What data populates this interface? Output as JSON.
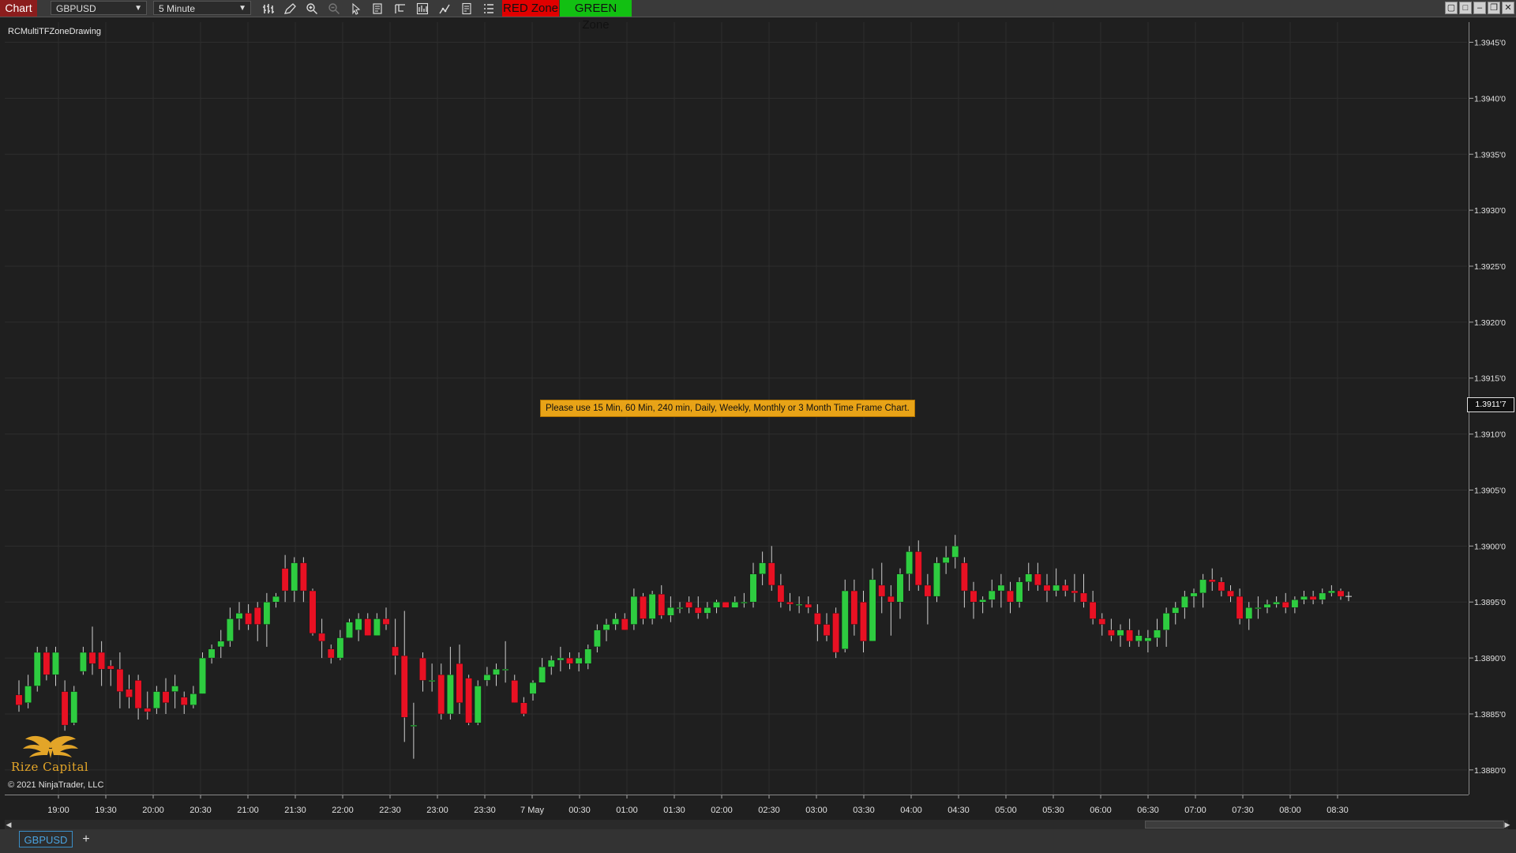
{
  "toolbar": {
    "chart_tab": "Chart",
    "instrument": "GBPUSD",
    "interval": "5 Minute",
    "red_zone": "RED Zone",
    "green_zone": "GREEN Zone",
    "icons": [
      "bar-type-icon",
      "pencil-draw-icon",
      "zoom-in-icon",
      "zoom-out-icon",
      "pointer-icon",
      "data-box-icon",
      "properties-icon",
      "indicators-icon",
      "strategies-icon",
      "order-icon",
      "objects-list-icon"
    ]
  },
  "chart": {
    "indicator_label": "RCMultiTFZoneDrawing",
    "notice": "Please use 15 Min, 60 Min, 240 min, Daily, Weekly, Monthly or 3 Month Time Frame Chart.",
    "copyright": "© 2021 NinjaTrader, LLC",
    "logo_text": "Rize Capital",
    "current_price": "1.3911'7",
    "colors": {
      "up": "#2ecc40",
      "down": "#e81123",
      "background": "#1f1f1f",
      "grid": "#2e2e2e"
    }
  },
  "chart_data": {
    "type": "candlestick",
    "title": "",
    "price_ticks": [
      "1.3880'0",
      "1.3885'0",
      "1.3890'0",
      "1.3895'0",
      "1.3900'0",
      "1.3905'0",
      "1.3910'0",
      "1.3915'0",
      "1.3920'0",
      "1.3925'0",
      "1.3930'0",
      "1.3935'0",
      "1.3940'0",
      "1.3945'0"
    ],
    "time_ticks": [
      "19:00",
      "19:30",
      "20:00",
      "20:30",
      "21:00",
      "21:30",
      "22:00",
      "22:30",
      "23:00",
      "23:30",
      "7 May",
      "00:30",
      "01:00",
      "01:30",
      "02:00",
      "02:30",
      "03:00",
      "03:30",
      "04:00",
      "04:30",
      "05:00",
      "05:30",
      "06:00",
      "06:30",
      "07:00",
      "07:30",
      "08:00",
      "08:30"
    ],
    "ylim": [
      1.38778,
      1.39468
    ],
    "grid": true,
    "candles": [
      [
        1.38867,
        1.3888,
        1.38852,
        1.38858
      ],
      [
        1.3886,
        1.38885,
        1.38855,
        1.38875
      ],
      [
        1.38875,
        1.3891,
        1.3887,
        1.38905
      ],
      [
        1.38905,
        1.3891,
        1.3888,
        1.38885
      ],
      [
        1.38885,
        1.3891,
        1.38875,
        1.38905
      ],
      [
        1.3887,
        1.3888,
        1.38835,
        1.3884
      ],
      [
        1.38842,
        1.38875,
        1.3884,
        1.3887
      ],
      [
        1.38888,
        1.3891,
        1.38885,
        1.38905
      ],
      [
        1.38905,
        1.38928,
        1.38885,
        1.38895
      ],
      [
        1.38905,
        1.38915,
        1.38875,
        1.3889
      ],
      [
        1.38893,
        1.38898,
        1.38875,
        1.3889
      ],
      [
        1.3889,
        1.38905,
        1.38855,
        1.3887
      ],
      [
        1.38872,
        1.38885,
        1.38855,
        1.38865
      ],
      [
        1.3888,
        1.38885,
        1.38845,
        1.38855
      ],
      [
        1.38855,
        1.3887,
        1.38845,
        1.38852
      ],
      [
        1.38855,
        1.38875,
        1.3885,
        1.3887
      ],
      [
        1.3887,
        1.38882,
        1.3885,
        1.3886
      ],
      [
        1.3887,
        1.38885,
        1.38855,
        1.38875
      ],
      [
        1.38865,
        1.3887,
        1.3885,
        1.38858
      ],
      [
        1.38858,
        1.38875,
        1.38855,
        1.38868
      ],
      [
        1.38868,
        1.38905,
        1.38868,
        1.389
      ],
      [
        1.389,
        1.38912,
        1.38895,
        1.38908
      ],
      [
        1.3891,
        1.38925,
        1.389,
        1.38915
      ],
      [
        1.38915,
        1.38945,
        1.3891,
        1.38935
      ],
      [
        1.38935,
        1.3895,
        1.38925,
        1.3894
      ],
      [
        1.3894,
        1.38948,
        1.38925,
        1.3893
      ],
      [
        1.38945,
        1.3895,
        1.38915,
        1.3893
      ],
      [
        1.3893,
        1.38958,
        1.3891,
        1.3895
      ],
      [
        1.3895,
        1.38958,
        1.38945,
        1.38955
      ],
      [
        1.3898,
        1.38992,
        1.3895,
        1.3896
      ],
      [
        1.3896,
        1.3899,
        1.3895,
        1.38985
      ],
      [
        1.38985,
        1.3899,
        1.3895,
        1.3896
      ],
      [
        1.3896,
        1.38962,
        1.3892,
        1.38922
      ],
      [
        1.38922,
        1.38935,
        1.389,
        1.38915
      ],
      [
        1.38908,
        1.38912,
        1.38895,
        1.389
      ],
      [
        1.389,
        1.38925,
        1.38898,
        1.38918
      ],
      [
        1.38918,
        1.38935,
        1.38918,
        1.38932
      ],
      [
        1.38925,
        1.3894,
        1.38915,
        1.38935
      ],
      [
        1.38935,
        1.3894,
        1.3892,
        1.3892
      ],
      [
        1.3892,
        1.3894,
        1.3892,
        1.38935
      ],
      [
        1.38935,
        1.38945,
        1.38925,
        1.3893
      ],
      [
        1.3891,
        1.38935,
        1.38885,
        1.38902
      ],
      [
        1.38902,
        1.38942,
        1.38825,
        1.38847
      ],
      [
        1.3884,
        1.3886,
        1.3881,
        1.3884
      ],
      [
        1.389,
        1.38905,
        1.3887,
        1.3888
      ],
      [
        1.3888,
        1.38895,
        1.3887,
        1.3888
      ],
      [
        1.38885,
        1.38895,
        1.38845,
        1.3885
      ],
      [
        1.3885,
        1.3891,
        1.38845,
        1.38885
      ],
      [
        1.38895,
        1.38912,
        1.3885,
        1.3886
      ],
      [
        1.38882,
        1.38885,
        1.3884,
        1.38842
      ],
      [
        1.38842,
        1.3888,
        1.3884,
        1.38875
      ],
      [
        1.3888,
        1.38892,
        1.38875,
        1.38885
      ],
      [
        1.38885,
        1.38895,
        1.38875,
        1.3889
      ],
      [
        1.3889,
        1.38915,
        1.38878,
        1.3889
      ],
      [
        1.3888,
        1.38885,
        1.3886,
        1.3886
      ],
      [
        1.3886,
        1.38865,
        1.38848,
        1.3885
      ],
      [
        1.38868,
        1.3888,
        1.38862,
        1.38878
      ],
      [
        1.38878,
        1.389,
        1.38878,
        1.38892
      ],
      [
        1.38892,
        1.38902,
        1.38885,
        1.38898
      ],
      [
        1.38898,
        1.3891,
        1.38888,
        1.389
      ],
      [
        1.389,
        1.38905,
        1.3889,
        1.38895
      ],
      [
        1.38895,
        1.38905,
        1.38888,
        1.389
      ],
      [
        1.38895,
        1.38912,
        1.3889,
        1.38908
      ],
      [
        1.3891,
        1.3893,
        1.38905,
        1.38925
      ],
      [
        1.38925,
        1.38935,
        1.38915,
        1.3893
      ],
      [
        1.3893,
        1.3894,
        1.38925,
        1.38935
      ],
      [
        1.38935,
        1.3894,
        1.38925,
        1.38925
      ],
      [
        1.3893,
        1.38962,
        1.38925,
        1.38955
      ],
      [
        1.38955,
        1.38958,
        1.3893,
        1.38935
      ],
      [
        1.38935,
        1.3896,
        1.3893,
        1.38957
      ],
      [
        1.38957,
        1.38965,
        1.38935,
        1.38938
      ],
      [
        1.38938,
        1.38955,
        1.38932,
        1.38945
      ],
      [
        1.38945,
        1.3895,
        1.3894,
        1.38945
      ],
      [
        1.3895,
        1.38955,
        1.3894,
        1.38945
      ],
      [
        1.38945,
        1.38955,
        1.38935,
        1.3894
      ],
      [
        1.3894,
        1.3895,
        1.38935,
        1.38945
      ],
      [
        1.38945,
        1.38952,
        1.3894,
        1.3895
      ],
      [
        1.3895,
        1.3895,
        1.38945,
        1.38945
      ],
      [
        1.38945,
        1.38955,
        1.38945,
        1.3895
      ],
      [
        1.3895,
        1.38958,
        1.38945,
        1.3895
      ],
      [
        1.3895,
        1.38985,
        1.38945,
        1.38975
      ],
      [
        1.38975,
        1.38995,
        1.38965,
        1.38985
      ],
      [
        1.38985,
        1.39,
        1.3896,
        1.38965
      ],
      [
        1.38965,
        1.38975,
        1.38945,
        1.3895
      ],
      [
        1.3895,
        1.38958,
        1.38942,
        1.38948
      ],
      [
        1.38948,
        1.38955,
        1.3894,
        1.38948
      ],
      [
        1.38948,
        1.38955,
        1.3894,
        1.38945
      ],
      [
        1.3894,
        1.38948,
        1.38915,
        1.3893
      ],
      [
        1.3893,
        1.3894,
        1.38915,
        1.3892
      ],
      [
        1.3894,
        1.38945,
        1.389,
        1.38905
      ],
      [
        1.38908,
        1.3897,
        1.38905,
        1.3896
      ],
      [
        1.3896,
        1.3897,
        1.3892,
        1.3893
      ],
      [
        1.3895,
        1.3896,
        1.38905,
        1.38915
      ],
      [
        1.38915,
        1.3898,
        1.38915,
        1.3897
      ],
      [
        1.38965,
        1.38985,
        1.3894,
        1.38955
      ],
      [
        1.38955,
        1.38965,
        1.3892,
        1.3895
      ],
      [
        1.3895,
        1.3898,
        1.38935,
        1.38975
      ],
      [
        1.38975,
        1.39,
        1.3896,
        1.38995
      ],
      [
        1.38995,
        1.39005,
        1.3896,
        1.38965
      ],
      [
        1.38965,
        1.38975,
        1.3893,
        1.38955
      ],
      [
        1.38955,
        1.3899,
        1.3895,
        1.38985
      ],
      [
        1.38985,
        1.39,
        1.38975,
        1.3899
      ],
      [
        1.3899,
        1.3901,
        1.3898,
        1.39
      ],
      [
        1.38985,
        1.3899,
        1.38945,
        1.3896
      ],
      [
        1.3896,
        1.38968,
        1.38935,
        1.3895
      ],
      [
        1.3895,
        1.38955,
        1.3894,
        1.38952
      ],
      [
        1.38952,
        1.3897,
        1.38945,
        1.3896
      ],
      [
        1.3896,
        1.38975,
        1.38945,
        1.38965
      ],
      [
        1.3896,
        1.38968,
        1.3894,
        1.3895
      ],
      [
        1.3895,
        1.38972,
        1.38945,
        1.38968
      ],
      [
        1.38968,
        1.38985,
        1.3896,
        1.38975
      ],
      [
        1.38975,
        1.38985,
        1.3896,
        1.38965
      ],
      [
        1.38965,
        1.38975,
        1.3895,
        1.3896
      ],
      [
        1.3896,
        1.3898,
        1.38955,
        1.38965
      ],
      [
        1.38965,
        1.3897,
        1.38955,
        1.3896
      ],
      [
        1.3896,
        1.38975,
        1.3895,
        1.38958
      ],
      [
        1.38958,
        1.38975,
        1.38945,
        1.3895
      ],
      [
        1.3895,
        1.3896,
        1.3893,
        1.38935
      ],
      [
        1.38935,
        1.3894,
        1.3892,
        1.3893
      ],
      [
        1.38925,
        1.38935,
        1.38915,
        1.3892
      ],
      [
        1.3892,
        1.3893,
        1.3891,
        1.38925
      ],
      [
        1.38925,
        1.38935,
        1.3891,
        1.38915
      ],
      [
        1.38915,
        1.38925,
        1.3891,
        1.3892
      ],
      [
        1.38915,
        1.38925,
        1.38905,
        1.38918
      ],
      [
        1.38918,
        1.38935,
        1.3891,
        1.38925
      ],
      [
        1.38925,
        1.38945,
        1.3891,
        1.3894
      ],
      [
        1.3894,
        1.3895,
        1.3893,
        1.38945
      ],
      [
        1.38945,
        1.3896,
        1.38935,
        1.38955
      ],
      [
        1.38955,
        1.38962,
        1.38945,
        1.38958
      ],
      [
        1.38958,
        1.38975,
        1.38945,
        1.3897
      ],
      [
        1.3897,
        1.3898,
        1.3896,
        1.38968
      ],
      [
        1.38968,
        1.38972,
        1.38955,
        1.3896
      ],
      [
        1.3896,
        1.38965,
        1.3895,
        1.38955
      ],
      [
        1.38955,
        1.38962,
        1.3893,
        1.38935
      ],
      [
        1.38935,
        1.3895,
        1.38925,
        1.38945
      ],
      [
        1.38945,
        1.38955,
        1.38935,
        1.38945
      ],
      [
        1.38945,
        1.38952,
        1.3894,
        1.38948
      ],
      [
        1.38948,
        1.38955,
        1.38945,
        1.3895
      ],
      [
        1.3895,
        1.38958,
        1.3894,
        1.38945
      ],
      [
        1.38945,
        1.38955,
        1.3894,
        1.38952
      ],
      [
        1.38952,
        1.3896,
        1.38948,
        1.38955
      ],
      [
        1.38955,
        1.3896,
        1.38948,
        1.38952
      ],
      [
        1.38952,
        1.38962,
        1.38948,
        1.38958
      ],
      [
        1.38958,
        1.38965,
        1.38955,
        1.3896
      ],
      [
        1.3896,
        1.38962,
        1.38952,
        1.38955
      ]
    ]
  },
  "tabs": {
    "active": "GBPUSD",
    "add": "+"
  }
}
